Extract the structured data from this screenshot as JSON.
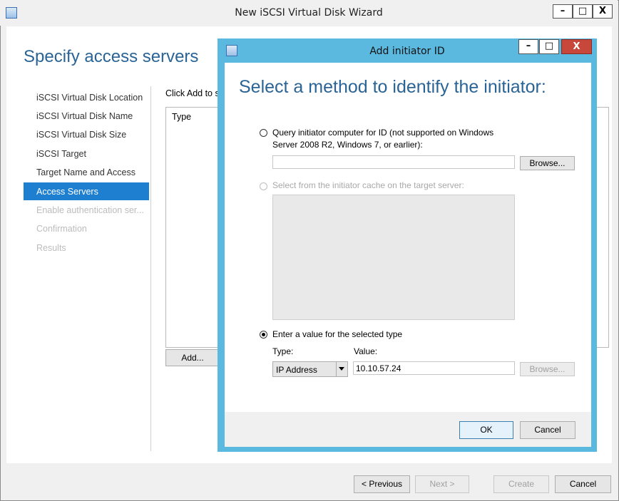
{
  "wizard": {
    "title": "New iSCSI Virtual Disk Wizard",
    "heading": "Specify access servers",
    "nav": [
      {
        "label": "iSCSI Virtual Disk Location",
        "state": "normal"
      },
      {
        "label": "iSCSI Virtual Disk Name",
        "state": "normal"
      },
      {
        "label": "iSCSI Virtual Disk Size",
        "state": "normal"
      },
      {
        "label": "iSCSI Target",
        "state": "normal"
      },
      {
        "label": "Target Name and Access",
        "state": "normal"
      },
      {
        "label": "Access Servers",
        "state": "active"
      },
      {
        "label": "Enable authentication ser...",
        "state": "disabled"
      },
      {
        "label": "Confirmation",
        "state": "disabled"
      },
      {
        "label": "Results",
        "state": "disabled"
      }
    ],
    "instruction": "Click Add to s",
    "list_header_type": "Type",
    "add_label": "Add...",
    "footer": {
      "previous": "< Previous",
      "next": "Next >",
      "create": "Create",
      "cancel": "Cancel"
    },
    "caption_buttons": {
      "minimize": "–",
      "maximize": "□",
      "close": "X"
    }
  },
  "dialog": {
    "title": "Add initiator ID",
    "heading": "Select a method to identify the initiator:",
    "option_query": "Query initiator computer for ID (not supported on Windows Server 2008 R2, Windows 7, or earlier):",
    "option_query_line1": "Query initiator computer for ID (not supported on Windows",
    "option_query_line2": "Server 2008 R2, Windows 7, or earlier):",
    "query_value": "",
    "browse_label": "Browse...",
    "option_cache": "Select from the initiator cache on the target server:",
    "option_enter": "Enter a value for the selected type",
    "type_label": "Type:",
    "value_label": "Value:",
    "type_selected": "IP Address",
    "value_text": "10.10.57.24",
    "browse2_label": "Browse...",
    "ok_label": "OK",
    "cancel_label": "Cancel",
    "caption_buttons": {
      "minimize": "–",
      "maximize": "□",
      "close": "X"
    }
  },
  "colors": {
    "accent": "#1e7fd0",
    "dialog_frame": "#5bb9df",
    "heading": "#2a6496",
    "close": "#c7473a"
  }
}
